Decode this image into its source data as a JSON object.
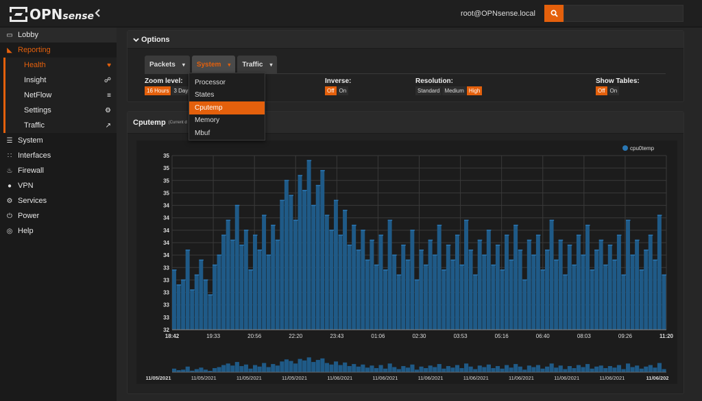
{
  "header": {
    "logo_main": "OPN",
    "logo_sub": "sense",
    "user": "root@OPNsense.local",
    "collapse_icon": "chevron-left-icon",
    "search_icon": "search-icon"
  },
  "sidebar": {
    "items": [
      {
        "label": "Lobby",
        "icon": "laptop-icon"
      },
      {
        "label": "Reporting",
        "icon": "area-chart-icon"
      },
      {
        "label": "System",
        "icon": "server-icon"
      },
      {
        "label": "Interfaces",
        "icon": "sitemap-icon"
      },
      {
        "label": "Firewall",
        "icon": "fire-icon"
      },
      {
        "label": "VPN",
        "icon": "globe-icon"
      },
      {
        "label": "Services",
        "icon": "cogs-icon"
      },
      {
        "label": "Power",
        "icon": "plug-icon"
      },
      {
        "label": "Help",
        "icon": "lifebuoy-icon"
      }
    ],
    "sub_items": [
      {
        "label": "Health",
        "icon": "heartbeat-icon"
      },
      {
        "label": "Insight",
        "icon": "binoculars-icon"
      },
      {
        "label": "NetFlow",
        "icon": "rss-icon"
      },
      {
        "label": "Settings",
        "icon": "gear-icon"
      },
      {
        "label": "Traffic",
        "icon": "line-chart-icon"
      }
    ]
  },
  "options": {
    "title": "Options",
    "tabs": [
      {
        "label": "Packets"
      },
      {
        "label": "System"
      },
      {
        "label": "Traffic"
      }
    ],
    "dropdown": [
      "Processor",
      "States",
      "Cputemp",
      "Memory",
      "Mbuf"
    ],
    "zoom": {
      "label": "Zoom level:",
      "options": [
        "16 Hours",
        "3 Days"
      ]
    },
    "inverse": {
      "label": "Inverse:",
      "options": [
        "Off",
        "On"
      ]
    },
    "resolution": {
      "label": "Resolution:",
      "options": [
        "Standard",
        "Medium",
        "High"
      ]
    },
    "show_tables": {
      "label": "Show Tables:",
      "options": [
        "Off",
        "On"
      ]
    }
  },
  "chart_panel": {
    "title": "Cputemp",
    "subtitle": "(Current d"
  },
  "colors": {
    "accent": "#e4600c",
    "series": "#2a77b4",
    "series_fill": "#1f5a87"
  },
  "chart_data": {
    "type": "area",
    "title": "",
    "legend": [
      "cpu0temp"
    ],
    "legend_position": "top-right",
    "grid": true,
    "y_ticks": [
      "35",
      "35",
      "35",
      "35",
      "34",
      "34",
      "34",
      "34",
      "34",
      "33",
      "33",
      "33",
      "33",
      "33",
      "32"
    ],
    "x_ticks": [
      "18:42",
      "19:33",
      "20:56",
      "22:20",
      "23:43",
      "01:06",
      "02:30",
      "03:53",
      "05:16",
      "06:40",
      "08:03",
      "09:26",
      "11:20"
    ],
    "navigator_ticks": [
      "11/05/2021",
      "11/05/2021",
      "11/05/2021",
      "11/05/2021",
      "11/06/2021",
      "11/06/2021",
      "11/06/2021",
      "11/06/2021",
      "11/06/2021",
      "11/06/2021",
      "11/06/2021",
      "11/06/202"
    ],
    "ylim": [
      32,
      35.5
    ],
    "series": [
      {
        "name": "cpu0temp",
        "values": [
          33.2,
          32.9,
          33.0,
          33.6,
          32.8,
          33.1,
          33.4,
          33.0,
          32.7,
          33.3,
          33.5,
          33.9,
          34.2,
          33.8,
          34.5,
          33.7,
          34.0,
          33.2,
          33.9,
          33.6,
          34.3,
          33.5,
          34.1,
          33.8,
          34.6,
          35.0,
          34.7,
          34.2,
          35.1,
          34.8,
          35.4,
          34.5,
          34.9,
          35.2,
          34.3,
          34.0,
          34.6,
          33.9,
          34.4,
          33.7,
          34.1,
          33.6,
          34.0,
          33.4,
          33.8,
          33.3,
          33.9,
          33.2,
          34.2,
          33.5,
          33.1,
          33.7,
          33.4,
          34.0,
          33.0,
          33.6,
          33.3,
          33.8,
          33.5,
          34.1,
          33.2,
          33.7,
          33.4,
          33.9,
          33.3,
          34.2,
          33.6,
          33.1,
          33.8,
          33.5,
          34.0,
          33.3,
          33.7,
          33.2,
          33.9,
          33.4,
          34.1,
          33.6,
          33.0,
          33.8,
          33.5,
          33.9,
          33.2,
          33.6,
          34.2,
          33.4,
          33.8,
          33.1,
          33.7,
          33.3,
          33.9,
          33.5,
          34.1,
          33.2,
          33.6,
          33.8,
          33.3,
          33.7,
          33.4,
          33.9,
          33.1,
          34.2,
          33.5,
          33.8,
          33.2,
          33.6,
          33.9,
          33.4,
          34.3,
          33.1
        ]
      }
    ]
  }
}
